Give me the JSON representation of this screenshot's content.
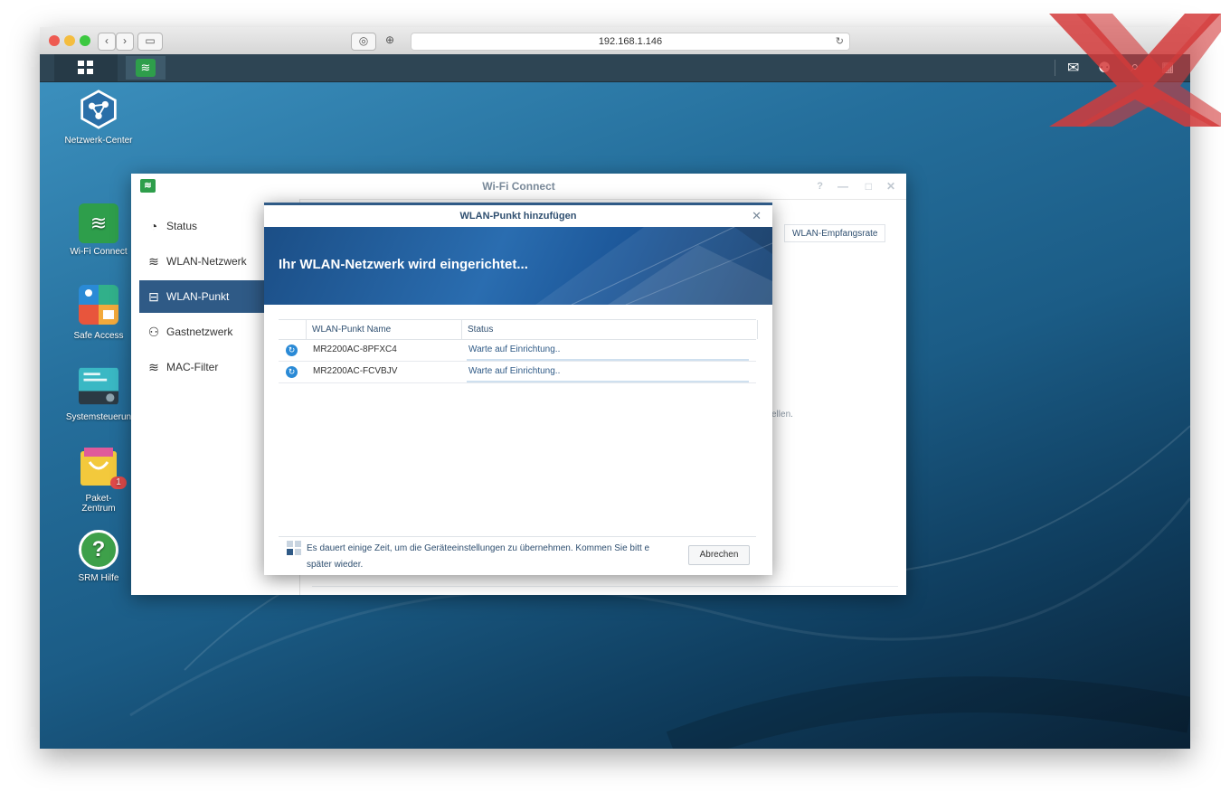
{
  "browser": {
    "url": "192.168.1.146"
  },
  "desktop": {
    "icons": [
      {
        "label": "Netzwerk-Center"
      },
      {
        "label": "Wi-Fi Connect"
      },
      {
        "label": "Safe Access"
      },
      {
        "label": "Systemsteuerun"
      },
      {
        "label": "Paket-Zentrum",
        "badge": "1"
      },
      {
        "label": "SRM Hilfe"
      }
    ]
  },
  "main_window": {
    "title": "Wi-Fi Connect",
    "sidebar": [
      {
        "label": "Status"
      },
      {
        "label": "WLAN-Netzwerk"
      },
      {
        "label": "WLAN-Punkt",
        "active": true
      },
      {
        "label": "Gastnetzwerk"
      },
      {
        "label": "MAC-Filter"
      }
    ],
    "bg_header_col": "WLAN-Empfangsrate",
    "bg_text_fragment": "ellen."
  },
  "dialog": {
    "title": "WLAN-Punkt hinzufügen",
    "banner": "Ihr WLAN-Netzwerk wird eingerichtet...",
    "table": {
      "columns": [
        "WLAN-Punkt Name",
        "Status"
      ],
      "rows": [
        {
          "name": "MR2200AC-8PFXC4",
          "status": "Warte auf Einrichtung.."
        },
        {
          "name": "MR2200AC-FCVBJV",
          "status": "Warte auf Einrichtung.."
        }
      ]
    },
    "footer_text": "Es dauert einige Zeit, um die Geräteeinstellungen zu übernehmen. Kommen Sie bitt e später wieder.",
    "abort_label": "Abrechen"
  },
  "colors": {
    "accent": "#2f5a86",
    "status_text": "#2f5a86",
    "icon_green": "#2e9e4b",
    "badge": "#e04a4a",
    "watermark": "#d33b3b"
  }
}
